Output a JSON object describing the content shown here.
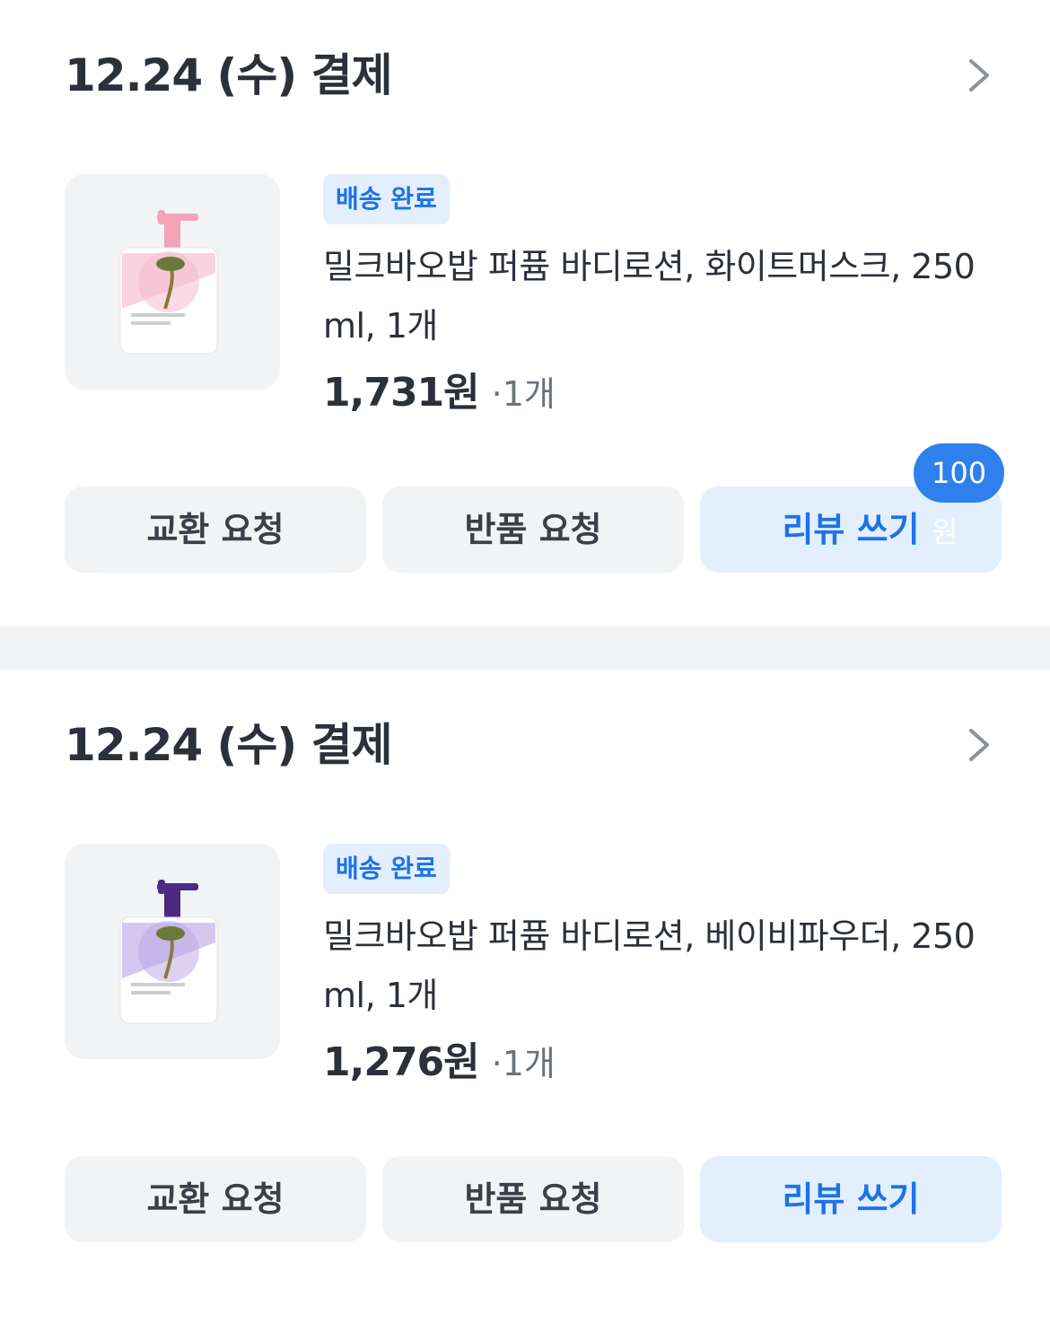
{
  "orders": [
    {
      "date_label": "12.24 (수) 결제",
      "status_badge": "배송 완료",
      "product_name": "밀크바오밥 퍼퓸 바디로션, 화이트머스크, 250ml, 1개",
      "price": "1,731원",
      "quantity": "·1개",
      "buttons": {
        "exchange": "교환 요청",
        "return": "반품 요청",
        "review": "리뷰 쓰기"
      },
      "review_reward": "100원",
      "cap_color": "#f2a3b9",
      "label_color": "#f5b8cc",
      "icon": "chevron-right-icon"
    },
    {
      "date_label": "12.24 (수) 결제",
      "status_badge": "배송 완료",
      "product_name": "밀크바오밥 퍼퓸 바디로션, 베이비파우더, 250ml, 1개",
      "price": "1,276원",
      "quantity": "·1개",
      "buttons": {
        "exchange": "교환 요청",
        "return": "반품 요청",
        "review": "리뷰 쓰기"
      },
      "cap_color": "#4a2a82",
      "label_color": "#b9a3e3",
      "icon": "chevron-right-icon"
    }
  ],
  "colors": {
    "accent": "#1d72e8",
    "badge_bg": "#e3effd",
    "button_bg": "#f2f3f5",
    "reward_bg": "#2f80ed"
  }
}
